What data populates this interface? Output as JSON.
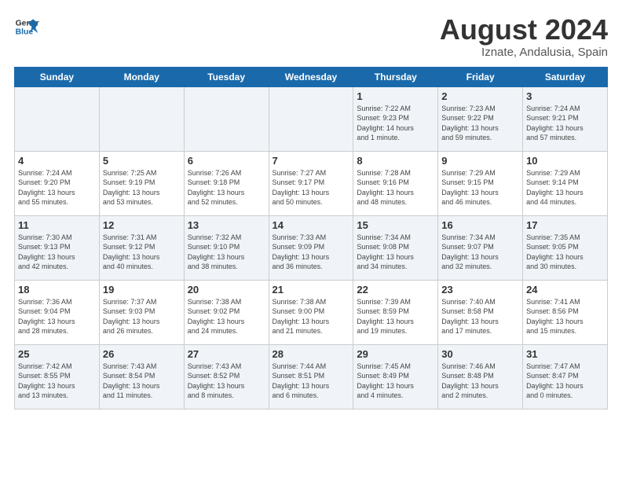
{
  "header": {
    "logo_line1": "General",
    "logo_line2": "Blue",
    "title": "August 2024",
    "subtitle": "Iznate, Andalusia, Spain"
  },
  "days_of_week": [
    "Sunday",
    "Monday",
    "Tuesday",
    "Wednesday",
    "Thursday",
    "Friday",
    "Saturday"
  ],
  "weeks": [
    [
      {
        "day": "",
        "content": ""
      },
      {
        "day": "",
        "content": ""
      },
      {
        "day": "",
        "content": ""
      },
      {
        "day": "",
        "content": ""
      },
      {
        "day": "1",
        "content": "Sunrise: 7:22 AM\nSunset: 9:23 PM\nDaylight: 14 hours\nand 1 minute."
      },
      {
        "day": "2",
        "content": "Sunrise: 7:23 AM\nSunset: 9:22 PM\nDaylight: 13 hours\nand 59 minutes."
      },
      {
        "day": "3",
        "content": "Sunrise: 7:24 AM\nSunset: 9:21 PM\nDaylight: 13 hours\nand 57 minutes."
      }
    ],
    [
      {
        "day": "4",
        "content": "Sunrise: 7:24 AM\nSunset: 9:20 PM\nDaylight: 13 hours\nand 55 minutes."
      },
      {
        "day": "5",
        "content": "Sunrise: 7:25 AM\nSunset: 9:19 PM\nDaylight: 13 hours\nand 53 minutes."
      },
      {
        "day": "6",
        "content": "Sunrise: 7:26 AM\nSunset: 9:18 PM\nDaylight: 13 hours\nand 52 minutes."
      },
      {
        "day": "7",
        "content": "Sunrise: 7:27 AM\nSunset: 9:17 PM\nDaylight: 13 hours\nand 50 minutes."
      },
      {
        "day": "8",
        "content": "Sunrise: 7:28 AM\nSunset: 9:16 PM\nDaylight: 13 hours\nand 48 minutes."
      },
      {
        "day": "9",
        "content": "Sunrise: 7:29 AM\nSunset: 9:15 PM\nDaylight: 13 hours\nand 46 minutes."
      },
      {
        "day": "10",
        "content": "Sunrise: 7:29 AM\nSunset: 9:14 PM\nDaylight: 13 hours\nand 44 minutes."
      }
    ],
    [
      {
        "day": "11",
        "content": "Sunrise: 7:30 AM\nSunset: 9:13 PM\nDaylight: 13 hours\nand 42 minutes."
      },
      {
        "day": "12",
        "content": "Sunrise: 7:31 AM\nSunset: 9:12 PM\nDaylight: 13 hours\nand 40 minutes."
      },
      {
        "day": "13",
        "content": "Sunrise: 7:32 AM\nSunset: 9:10 PM\nDaylight: 13 hours\nand 38 minutes."
      },
      {
        "day": "14",
        "content": "Sunrise: 7:33 AM\nSunset: 9:09 PM\nDaylight: 13 hours\nand 36 minutes."
      },
      {
        "day": "15",
        "content": "Sunrise: 7:34 AM\nSunset: 9:08 PM\nDaylight: 13 hours\nand 34 minutes."
      },
      {
        "day": "16",
        "content": "Sunrise: 7:34 AM\nSunset: 9:07 PM\nDaylight: 13 hours\nand 32 minutes."
      },
      {
        "day": "17",
        "content": "Sunrise: 7:35 AM\nSunset: 9:05 PM\nDaylight: 13 hours\nand 30 minutes."
      }
    ],
    [
      {
        "day": "18",
        "content": "Sunrise: 7:36 AM\nSunset: 9:04 PM\nDaylight: 13 hours\nand 28 minutes."
      },
      {
        "day": "19",
        "content": "Sunrise: 7:37 AM\nSunset: 9:03 PM\nDaylight: 13 hours\nand 26 minutes."
      },
      {
        "day": "20",
        "content": "Sunrise: 7:38 AM\nSunset: 9:02 PM\nDaylight: 13 hours\nand 24 minutes."
      },
      {
        "day": "21",
        "content": "Sunrise: 7:38 AM\nSunset: 9:00 PM\nDaylight: 13 hours\nand 21 minutes."
      },
      {
        "day": "22",
        "content": "Sunrise: 7:39 AM\nSunset: 8:59 PM\nDaylight: 13 hours\nand 19 minutes."
      },
      {
        "day": "23",
        "content": "Sunrise: 7:40 AM\nSunset: 8:58 PM\nDaylight: 13 hours\nand 17 minutes."
      },
      {
        "day": "24",
        "content": "Sunrise: 7:41 AM\nSunset: 8:56 PM\nDaylight: 13 hours\nand 15 minutes."
      }
    ],
    [
      {
        "day": "25",
        "content": "Sunrise: 7:42 AM\nSunset: 8:55 PM\nDaylight: 13 hours\nand 13 minutes."
      },
      {
        "day": "26",
        "content": "Sunrise: 7:43 AM\nSunset: 8:54 PM\nDaylight: 13 hours\nand 11 minutes."
      },
      {
        "day": "27",
        "content": "Sunrise: 7:43 AM\nSunset: 8:52 PM\nDaylight: 13 hours\nand 8 minutes."
      },
      {
        "day": "28",
        "content": "Sunrise: 7:44 AM\nSunset: 8:51 PM\nDaylight: 13 hours\nand 6 minutes."
      },
      {
        "day": "29",
        "content": "Sunrise: 7:45 AM\nSunset: 8:49 PM\nDaylight: 13 hours\nand 4 minutes."
      },
      {
        "day": "30",
        "content": "Sunrise: 7:46 AM\nSunset: 8:48 PM\nDaylight: 13 hours\nand 2 minutes."
      },
      {
        "day": "31",
        "content": "Sunrise: 7:47 AM\nSunset: 8:47 PM\nDaylight: 13 hours\nand 0 minutes."
      }
    ]
  ]
}
